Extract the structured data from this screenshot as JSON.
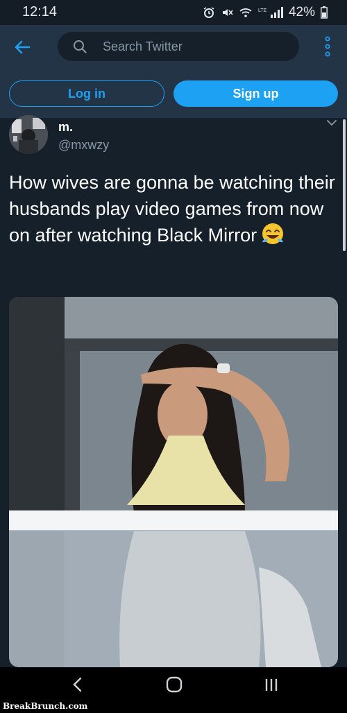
{
  "status_bar": {
    "time": "12:14",
    "battery": "42%",
    "icons": [
      "alarm-icon",
      "mute-icon",
      "wifi-icon",
      "lte-signal-icon",
      "battery-icon"
    ]
  },
  "header": {
    "back_icon": "arrow-left-icon",
    "search_placeholder": "Search Twitter",
    "more_icon": "vertical-dots-icon"
  },
  "auth": {
    "login_label": "Log in",
    "signup_label": "Sign up"
  },
  "tweet": {
    "display_name": "m.",
    "handle": "@mxwzy",
    "text": "How wives are gonna be watching their husbands play video games from now on after watching Black Mirror",
    "emoji": "face-with-tears-of-joy-icon"
  },
  "nav": {
    "icons": [
      "back-nav-icon",
      "home-nav-icon",
      "recents-nav-icon"
    ]
  },
  "watermark": "BreakBrunch.com",
  "colors": {
    "background": "#15202b",
    "header": "#243447",
    "accent": "#1da1f2",
    "secondary_text": "#8899a6"
  }
}
